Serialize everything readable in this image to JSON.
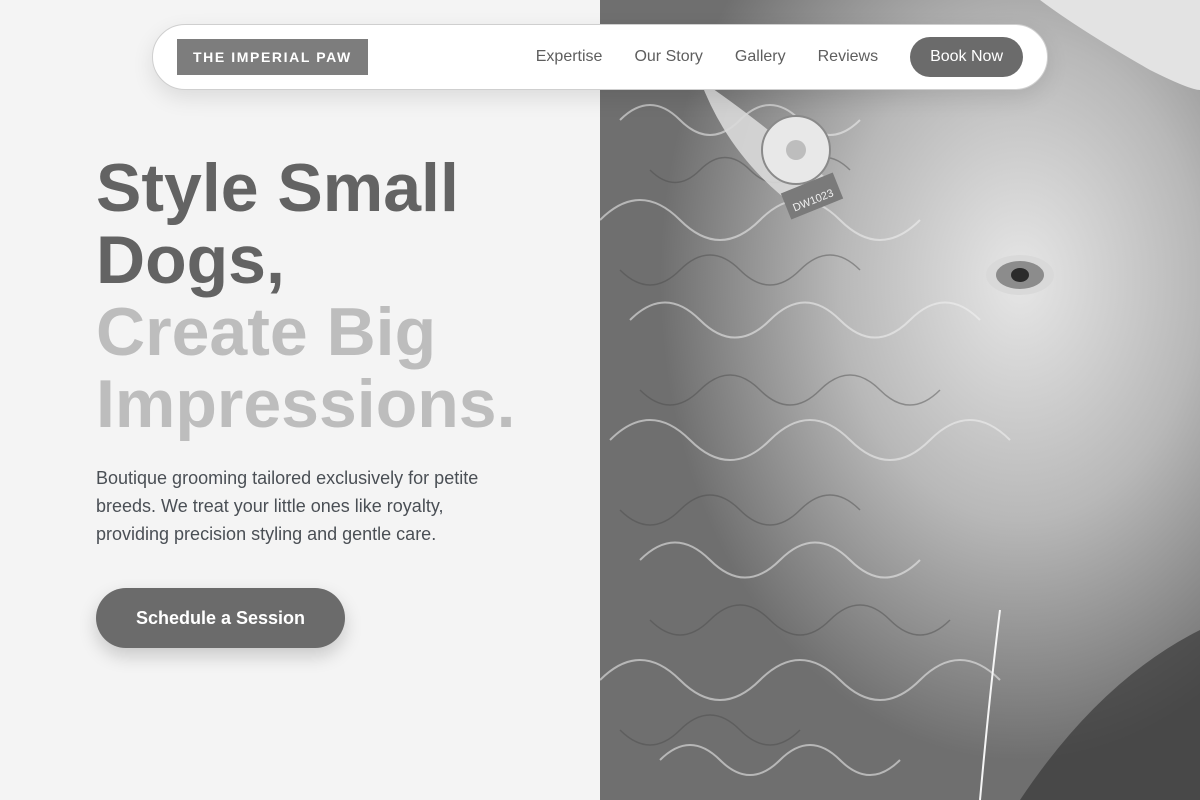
{
  "nav": {
    "brand": "THE IMPERIAL PAW",
    "links": [
      "Expertise",
      "Our Story",
      "Gallery",
      "Reviews"
    ],
    "cta": "Book Now"
  },
  "hero": {
    "headline_line1": "Style Small Dogs,",
    "headline_line2": "Create Big Impressions.",
    "subtext": "Boutique grooming tailored exclusively for petite breeds. We treat your little ones like royalty, providing precision styling and gentle care.",
    "cta": "Schedule a Session"
  },
  "photo": {
    "subject": "close-up black-and-white photo of a curly-fleeced sheep with ear tags",
    "ear_tag_text": "DW1023"
  },
  "colors": {
    "background": "#f4f4f4",
    "heading_dark": "#636363",
    "heading_light": "#bdbdbd",
    "button": "#6b6b6b",
    "brand_bg": "#7d7d7d",
    "body_text": "#4a4f55"
  }
}
